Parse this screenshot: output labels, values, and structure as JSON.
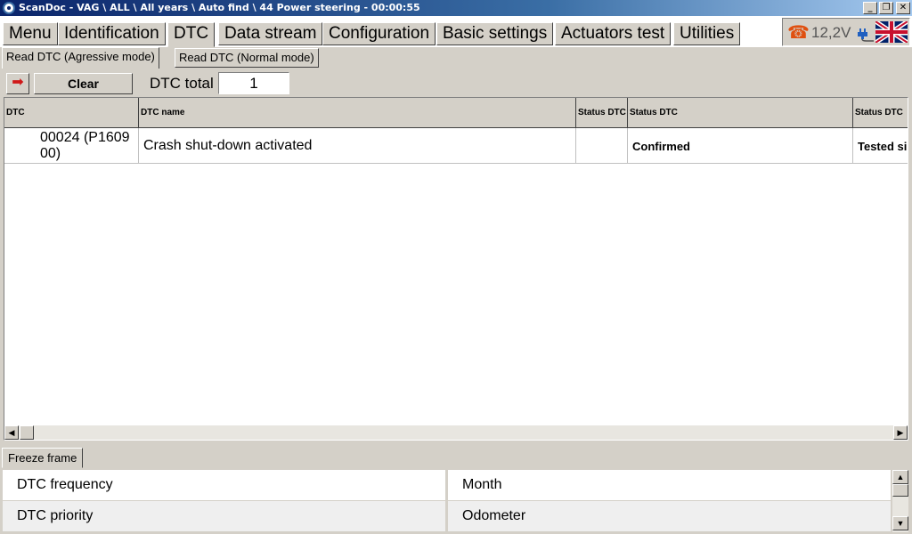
{
  "window": {
    "title": "ScanDoc - VAG \\ ALL \\ All years \\ Auto find \\ 44 Power steering - 00:00:55",
    "min_glyph": "_",
    "max_glyph": "❐",
    "close_glyph": "✕"
  },
  "menu": {
    "tabs": [
      "Menu",
      "Identification",
      "DTC",
      "Data stream",
      "Configuration",
      "Basic settings",
      "Actuators test",
      "Utilities"
    ],
    "active": "DTC"
  },
  "status": {
    "voltage": "12,2V",
    "phone_glyph": "☎",
    "icons": [
      "phone-icon",
      "plug-icon",
      "uk-flag-icon"
    ]
  },
  "subtabs": {
    "items": [
      "Read DTC (Agressive mode)",
      "Read DTC (Normal mode)"
    ],
    "active": "Read DTC (Agressive mode)"
  },
  "toolbar": {
    "nav_glyph": "➡",
    "clear_label": "Clear",
    "dtc_total_label": "DTC total",
    "dtc_total_value": "1"
  },
  "table": {
    "headers": [
      "DTC",
      "DTC name",
      "Status DTC",
      "Status DTC",
      "Status DTC"
    ],
    "rows": [
      {
        "dtc_line1": "00024 (P1609",
        "dtc_line2": "00)",
        "name": "Crash shut-down activated",
        "status1": "",
        "status2": "Confirmed",
        "status3": "Tested si"
      }
    ],
    "scroll_left": "◀",
    "scroll_right": "▶"
  },
  "freeze_frame": {
    "tab_label": "Freeze frame",
    "fields": [
      "DTC frequency",
      "Month",
      "DTC priority",
      "Odometer"
    ],
    "scroll_up": "▲",
    "scroll_down": "▼"
  },
  "colors": {
    "titlebar_start": "#0a246a",
    "face": "#d4d0c8",
    "accent_arrow": "#d01818",
    "phone": "#e05010"
  }
}
